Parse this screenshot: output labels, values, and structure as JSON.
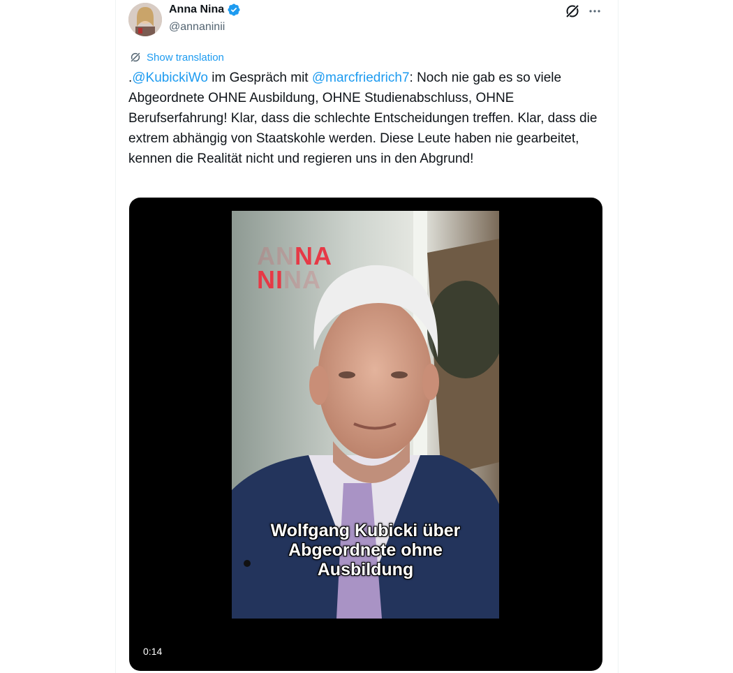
{
  "author": {
    "name": "Anna Nina",
    "handle": "@annaninii"
  },
  "show_translation": "Show translation",
  "tweet": {
    "prefix": ".",
    "mention1": "@KubickiWo",
    "middle": " im Gespräch mit ",
    "mention2": "@marcfriedrich7",
    "body": ": Noch nie gab es so viele Abgeordnete OHNE Ausbildung, OHNE Studienabschluss, OHNE Berufserfahrung! Klar, dass die schlechte Entscheidungen treffen. Klar, dass die extrem abhängig von Staatskohle werden. Diese Leute haben nie gearbeitet, kennen die Realität nicht und regieren uns in den Abgrund!"
  },
  "video": {
    "logo_line1_faint": "AN",
    "logo_line1": "NA",
    "logo_line2": "NI",
    "logo_line2_faint": "NA",
    "caption_line1": "Wolfgang Kubicki über",
    "caption_line2": "Abgeordnete ohne",
    "caption_line3": "Ausbildung",
    "duration": "0:14"
  },
  "colors": {
    "accent": "#1d9bf0",
    "text": "#0f1419",
    "secondary": "#536471",
    "logo_red": "#e63946"
  },
  "icons": [
    "verified-badge-icon",
    "grok-icon",
    "more-icon",
    "translate-icon"
  ]
}
